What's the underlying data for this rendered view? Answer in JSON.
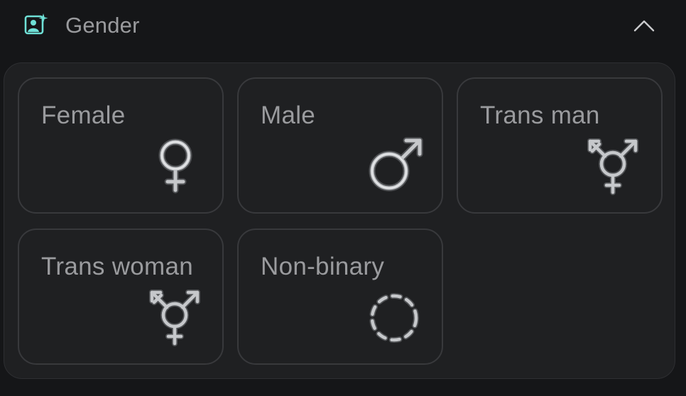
{
  "header": {
    "title": "Gender",
    "icon": "portrait-sparkle-icon",
    "collapse_icon": "chevron-up-icon"
  },
  "options": [
    {
      "label": "Female",
      "icon": "female-symbol-icon"
    },
    {
      "label": "Male",
      "icon": "male-symbol-icon"
    },
    {
      "label": "Trans man",
      "icon": "transgender-symbol-icon"
    },
    {
      "label": "Trans woman",
      "icon": "transgender-symbol-icon"
    },
    {
      "label": "Non-binary",
      "icon": "dashed-circle-icon"
    }
  ],
  "colors": {
    "background": "#151618",
    "panel": "#1f2022",
    "card_border": "#38393c",
    "text": "#9a9b9e",
    "accent": "#6fe0d6"
  }
}
